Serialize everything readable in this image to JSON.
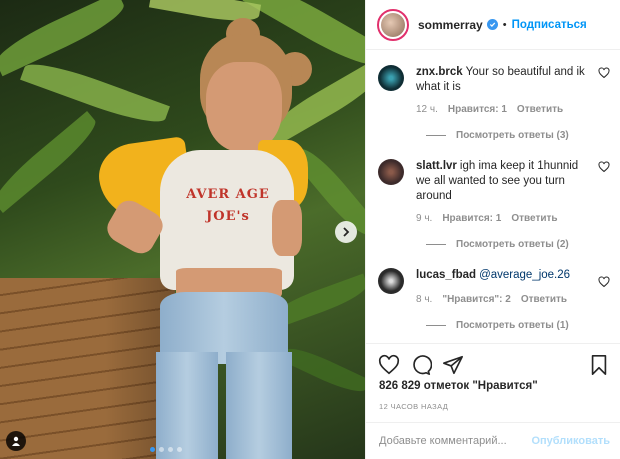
{
  "post": {
    "username": "sommerray",
    "follow_label": "Подписаться",
    "separator": "•",
    "verified_icon": "verified-badge-icon"
  },
  "comments": [
    {
      "username": "znx.brck",
      "text": "Your so beautiful and ik what it is",
      "time": "12 ч.",
      "likes": "Нравится: 1",
      "reply": "Ответить",
      "replies": "Посмотреть ответы (3)",
      "avatar_color": "#0f2d34"
    },
    {
      "username": "slatt.lvr",
      "text": "igh ima keep it 1hunnid we all wanted to see you turn around",
      "time": "9 ч.",
      "likes": "Нравится: 1",
      "reply": "Ответить",
      "replies": "Посмотреть ответы (2)",
      "avatar_color": "#3d2b2b"
    },
    {
      "username": "lucas_fbad",
      "mention": "@average_joe.26",
      "time": "8 ч.",
      "likes": "\"Нравится\": 2",
      "reply": "Ответить",
      "replies": "Посмотреть ответы (1)",
      "avatar_color": "#2b2b2b"
    }
  ],
  "likes_count": "826 829 отметок \"Нравится\"",
  "timestamp": "12 ЧАСОВ НАЗАД",
  "comment_input": {
    "placeholder": "Добавьте комментарий...",
    "submit_label": "Опубликовать"
  },
  "photo": {
    "shirt_text_line1": "AVER AGE",
    "shirt_text_line2": "JOE's",
    "carousel_count": 4,
    "carousel_active": 1
  },
  "colors": {
    "accent": "#0095f6",
    "secondary_text": "#8e8e8e",
    "mention": "#00376b"
  }
}
